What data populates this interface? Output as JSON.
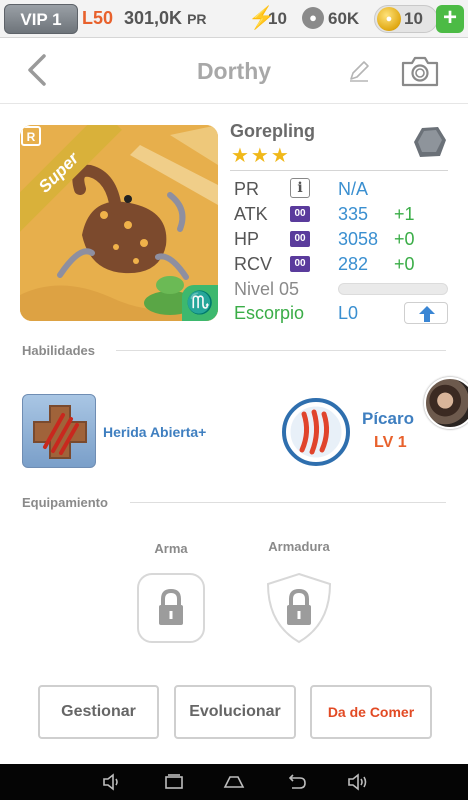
{
  "topbar": {
    "vip": "VIP 1",
    "level": "L50",
    "pr_total": "301,0K",
    "pr_suffix": "PR",
    "energy": "10",
    "paw_currency": "60K",
    "gold": "10",
    "plus": "+"
  },
  "header": {
    "title": "Dorthy"
  },
  "monster": {
    "species": "Gorepling",
    "stars": "★★★",
    "rarity_tag": "Super",
    "rarity_letter": "R",
    "zodiac_symbol": "♏",
    "stats": {
      "pr": {
        "label": "PR",
        "value": "N/A"
      },
      "atk": {
        "label": "ATK",
        "badge": "00",
        "value": "335",
        "bonus": "+1"
      },
      "hp": {
        "label": "HP",
        "badge": "00",
        "value": "3058",
        "bonus": "+0"
      },
      "rcv": {
        "label": "RCV",
        "badge": "00",
        "value": "282",
        "bonus": "+0"
      },
      "level": {
        "label": "Nivel 05",
        "progress": 0
      },
      "element": {
        "label": "Escorpio",
        "level": "L0"
      }
    }
  },
  "skills": {
    "title": "Habilidades",
    "active": {
      "name": "Herida Abierta+"
    },
    "trait": {
      "name": "Pícaro",
      "level": "LV 1"
    }
  },
  "equipment": {
    "title": "Equipamiento",
    "weapon": "Arma",
    "armor": "Armadura"
  },
  "actions": {
    "manage": "Gestionar",
    "evolve": "Evolucionar",
    "feed": "Da de Comer"
  },
  "colors": {
    "accent_orange": "#e8612c",
    "link_blue": "#3a8fd0",
    "bonus_green": "#3aad47",
    "plus_green": "#4cbb45"
  }
}
